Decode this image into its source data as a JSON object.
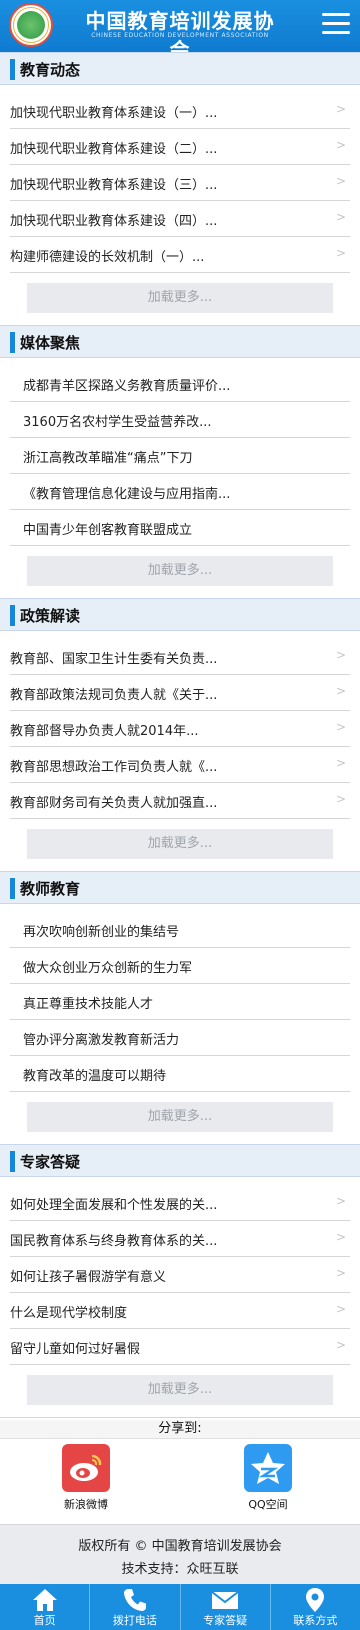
{
  "header": {
    "title": "中国教育培训发展协会",
    "subtitle": "CHINESE EDUCATION DEVELOPMENT ASSOCIATION"
  },
  "sections": [
    {
      "title": "教育动态",
      "indent": false,
      "items": [
        "加快现代职业教育体系建设（一）...",
        "加快现代职业教育体系建设（二）...",
        "加快现代职业教育体系建设（三）...",
        "加快现代职业教育体系建设（四）...",
        "构建师德建设的长效机制（一）..."
      ],
      "more": "加载更多..."
    },
    {
      "title": "媒体聚焦",
      "indent": true,
      "items": [
        "成都青羊区探路义务教育质量评价...",
        "3160万名农村学生受益营养改...",
        "浙江高教改革瞄准“痛点”下刀",
        "《教育管理信息化建设与应用指南...",
        "中国青少年创客教育联盟成立"
      ],
      "more": "加载更多..."
    },
    {
      "title": "政策解读",
      "indent": false,
      "items": [
        "教育部、国家卫生计生委有关负责...",
        "教育部政策法规司负责人就《关于...",
        "教育部督导办负责人就2014年...",
        "教育部思想政治工作司负责人就《...",
        "教育部财务司有关负责人就加强直..."
      ],
      "more": "加载更多..."
    },
    {
      "title": "教师教育",
      "indent": true,
      "items": [
        "再次吹响创新创业的集结号",
        "做大众创业万众创新的生力军",
        "真正尊重技术技能人才",
        "管办评分离激发教育新活力",
        "教育改革的温度可以期待"
      ],
      "more": "加载更多..."
    },
    {
      "title": "专家答疑",
      "indent": false,
      "items": [
        "如何处理全面发展和个性发展的关...",
        "国民教育体系与终身教育体系的关...",
        "如何让孩子暑假游学有意义",
        "什么是现代学校制度",
        "留守儿童如何过好暑假"
      ],
      "more": "加载更多..."
    }
  ],
  "chevron": ">",
  "share": {
    "label": "分享到:",
    "targets": [
      {
        "name": "新浪微博",
        "icon": "weibo-icon",
        "color": "#e64545"
      },
      {
        "name": "QQ空间",
        "icon": "qzone-icon",
        "color": "#2f9bf0"
      }
    ]
  },
  "footer": {
    "copyright": "版权所有 © 中国教育培训发展协会",
    "support": "技术支持：众旺互联"
  },
  "bottom_nav": [
    {
      "label": "首页",
      "icon": "home-icon"
    },
    {
      "label": "拨打电话",
      "icon": "phone-icon"
    },
    {
      "label": "专家答疑",
      "icon": "mail-icon"
    },
    {
      "label": "联系方式",
      "icon": "location-icon"
    }
  ],
  "colors": {
    "accent": "#1a8fe0",
    "section_bg": "#e6eef8",
    "more_bg": "#e8eaee"
  }
}
